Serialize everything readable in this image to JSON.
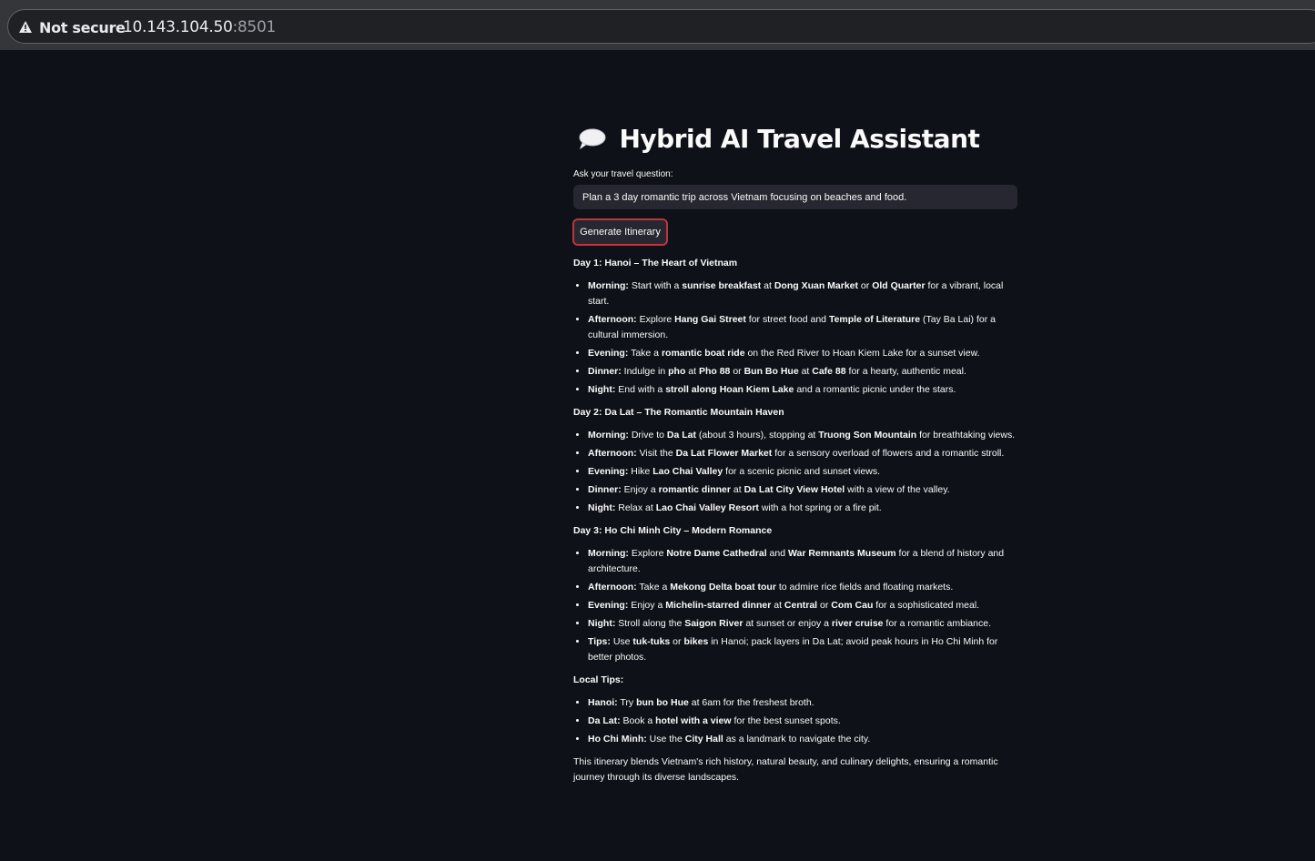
{
  "browser": {
    "security_label": "Not secure",
    "host": "10.143.104.50",
    "port": ":8501"
  },
  "app": {
    "title": "Hybrid AI Travel Assistant",
    "title_icon": "speech-bubble-icon",
    "question_label": "Ask your travel question:",
    "question_value": "Plan a 3 day romantic trip across Vietnam focusing on beaches and food.",
    "generate_button": "Generate Itinerary"
  },
  "itinerary": {
    "sections": [
      {
        "heading": "Day 1: Hanoi – The Heart of Vietnam",
        "items": [
          [
            {
              "b": "Morning:"
            },
            {
              "t": " Start with a "
            },
            {
              "b": "sunrise breakfast"
            },
            {
              "t": " at "
            },
            {
              "b": "Dong Xuan Market"
            },
            {
              "t": " or "
            },
            {
              "b": "Old Quarter"
            },
            {
              "t": " for a vibrant, local start."
            }
          ],
          [
            {
              "b": "Afternoon:"
            },
            {
              "t": " Explore "
            },
            {
              "b": "Hang Gai Street"
            },
            {
              "t": " for street food and "
            },
            {
              "b": "Temple of Literature"
            },
            {
              "t": " (Tay Ba Lai) for a cultural immersion."
            }
          ],
          [
            {
              "b": "Evening:"
            },
            {
              "t": " Take a "
            },
            {
              "b": "romantic boat ride"
            },
            {
              "t": " on the Red River to Hoan Kiem Lake for a sunset view."
            }
          ],
          [
            {
              "b": "Dinner:"
            },
            {
              "t": " Indulge in "
            },
            {
              "b": "pho"
            },
            {
              "t": " at "
            },
            {
              "b": "Pho 88"
            },
            {
              "t": " or "
            },
            {
              "b": "Bun Bo Hue"
            },
            {
              "t": " at "
            },
            {
              "b": "Cafe 88"
            },
            {
              "t": " for a hearty, authentic meal."
            }
          ],
          [
            {
              "b": "Night:"
            },
            {
              "t": " End with a "
            },
            {
              "b": "stroll along Hoan Kiem Lake"
            },
            {
              "t": " and a romantic picnic under the stars."
            }
          ]
        ]
      },
      {
        "heading": "Day 2: Da Lat – The Romantic Mountain Haven",
        "items": [
          [
            {
              "b": "Morning:"
            },
            {
              "t": " Drive to "
            },
            {
              "b": "Da Lat"
            },
            {
              "t": " (about 3 hours), stopping at "
            },
            {
              "b": "Truong Son Mountain"
            },
            {
              "t": " for breathtaking views."
            }
          ],
          [
            {
              "b": "Afternoon:"
            },
            {
              "t": " Visit the "
            },
            {
              "b": "Da Lat Flower Market"
            },
            {
              "t": " for a sensory overload of flowers and a romantic stroll."
            }
          ],
          [
            {
              "b": "Evening:"
            },
            {
              "t": " Hike "
            },
            {
              "b": "Lao Chai Valley"
            },
            {
              "t": " for a scenic picnic and sunset views."
            }
          ],
          [
            {
              "b": "Dinner:"
            },
            {
              "t": " Enjoy a "
            },
            {
              "b": "romantic dinner"
            },
            {
              "t": " at "
            },
            {
              "b": "Da Lat City View Hotel"
            },
            {
              "t": " with a view of the valley."
            }
          ],
          [
            {
              "b": "Night:"
            },
            {
              "t": " Relax at "
            },
            {
              "b": "Lao Chai Valley Resort"
            },
            {
              "t": " with a hot spring or a fire pit."
            }
          ]
        ]
      },
      {
        "heading": "Day 3: Ho Chi Minh City – Modern Romance",
        "items": [
          [
            {
              "b": "Morning:"
            },
            {
              "t": " Explore "
            },
            {
              "b": "Notre Dame Cathedral"
            },
            {
              "t": " and "
            },
            {
              "b": "War Remnants Museum"
            },
            {
              "t": " for a blend of history and architecture."
            }
          ],
          [
            {
              "b": "Afternoon:"
            },
            {
              "t": " Take a "
            },
            {
              "b": "Mekong Delta boat tour"
            },
            {
              "t": " to admire rice fields and floating markets."
            }
          ],
          [
            {
              "b": "Evening:"
            },
            {
              "t": " Enjoy a "
            },
            {
              "b": "Michelin-starred dinner"
            },
            {
              "t": " at "
            },
            {
              "b": "Central"
            },
            {
              "t": " or "
            },
            {
              "b": "Com Cau"
            },
            {
              "t": " for a sophisticated meal."
            }
          ],
          [
            {
              "b": "Night:"
            },
            {
              "t": " Stroll along the "
            },
            {
              "b": "Saigon River"
            },
            {
              "t": " at sunset or enjoy a "
            },
            {
              "b": "river cruise"
            },
            {
              "t": " for a romantic ambiance."
            }
          ],
          [
            {
              "b": "Tips:"
            },
            {
              "t": " Use "
            },
            {
              "b": "tuk-tuks"
            },
            {
              "t": " or "
            },
            {
              "b": "bikes"
            },
            {
              "t": " in Hanoi; pack layers in Da Lat; avoid peak hours in Ho Chi Minh for better photos."
            }
          ]
        ]
      },
      {
        "heading": "Local Tips:",
        "items": [
          [
            {
              "b": "Hanoi:"
            },
            {
              "t": " Try "
            },
            {
              "b": "bun bo Hue"
            },
            {
              "t": " at 6am for the freshest broth."
            }
          ],
          [
            {
              "b": "Da Lat:"
            },
            {
              "t": " Book a "
            },
            {
              "b": "hotel with a view"
            },
            {
              "t": " for the best sunset spots."
            }
          ],
          [
            {
              "b": "Ho Chi Minh:"
            },
            {
              "t": " Use the "
            },
            {
              "b": "City Hall"
            },
            {
              "t": " as a landmark to navigate the city."
            }
          ]
        ]
      }
    ],
    "closing": "This itinerary blends Vietnam's rich history, natural beauty, and culinary delights, ensuring a romantic journey through its diverse landscapes."
  }
}
